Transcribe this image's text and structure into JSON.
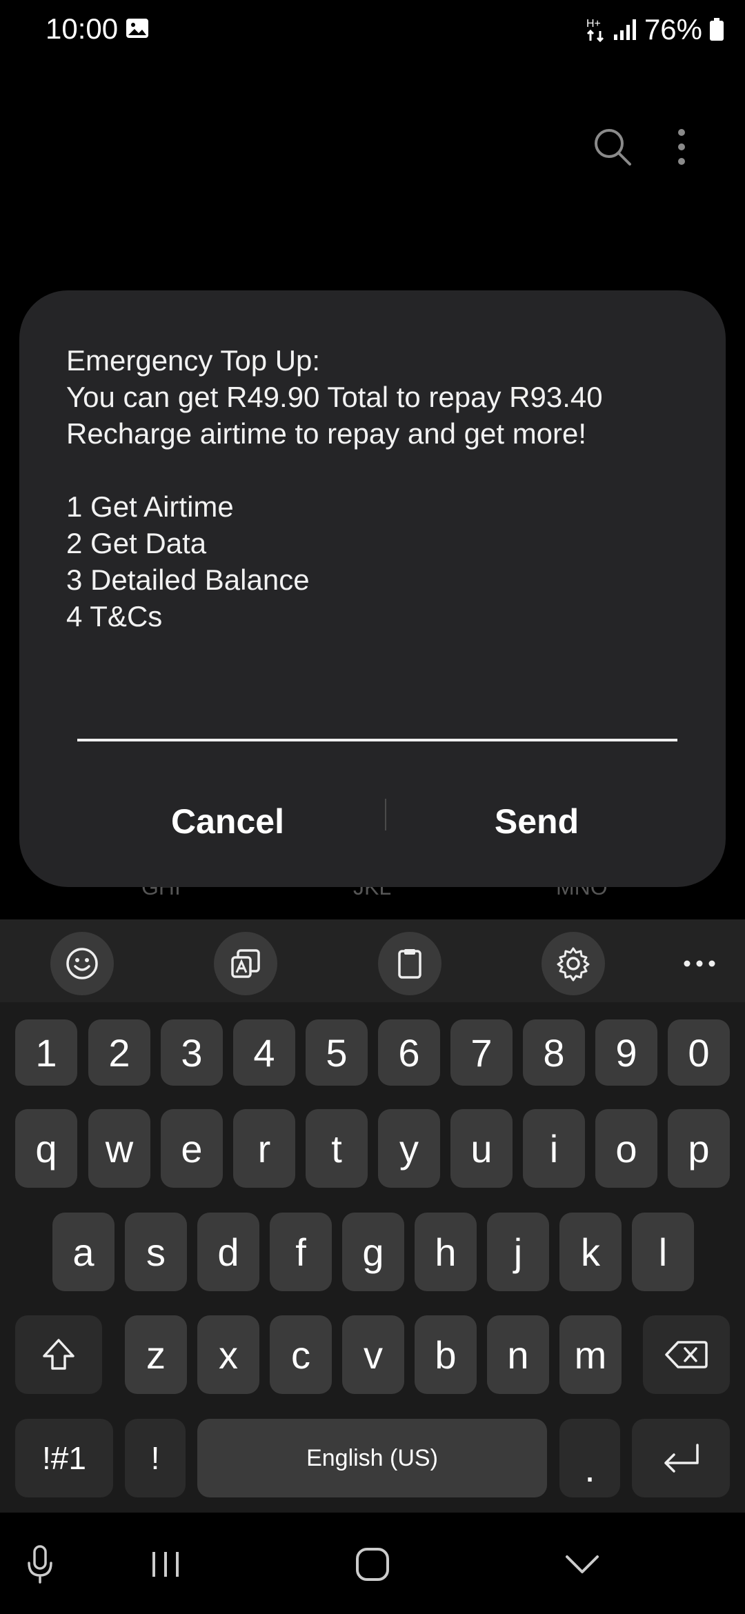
{
  "status_bar": {
    "time": "10:00",
    "network": "H+",
    "battery": "76%",
    "icons": [
      "gallery-icon",
      "data-arrows-icon",
      "signal-icon",
      "battery-icon"
    ]
  },
  "background_app": {
    "toolbar_icons": [
      "search-icon",
      "more-vert-icon"
    ],
    "t9_hints": [
      "GHI",
      "JKL",
      "MNO"
    ]
  },
  "dialog": {
    "message": "Emergency Top Up:\nYou can get R49.90 Total to repay R93.40\nRecharge airtime to repay and get more!\n\n1 Get Airtime\n2 Get Data\n3 Detailed Balance\n4 T&Cs",
    "input_value": "",
    "cancel_label": "Cancel",
    "send_label": "Send"
  },
  "keyboard": {
    "toolbar": [
      "emoji-icon",
      "translate-icon",
      "clipboard-icon",
      "settings-icon",
      "more-horiz-icon"
    ],
    "number_row": [
      "1",
      "2",
      "3",
      "4",
      "5",
      "6",
      "7",
      "8",
      "9",
      "0"
    ],
    "row1": [
      "q",
      "w",
      "e",
      "r",
      "t",
      "y",
      "u",
      "i",
      "o",
      "p"
    ],
    "row2": [
      "a",
      "s",
      "d",
      "f",
      "g",
      "h",
      "j",
      "k",
      "l"
    ],
    "row3": [
      "z",
      "x",
      "c",
      "v",
      "b",
      "n",
      "m"
    ],
    "symbols_label": "!#1",
    "exclaim_label": "!",
    "space_label": "English (US)",
    "period_label": "."
  },
  "nav_bar": {
    "items": [
      "mic-icon",
      "recents-icon",
      "home-icon",
      "hide-keyboard-icon"
    ]
  },
  "colors": {
    "background": "#000000",
    "dialog": "#252527",
    "key": "#3b3b3b",
    "keyboard": "#1b1b1b"
  }
}
